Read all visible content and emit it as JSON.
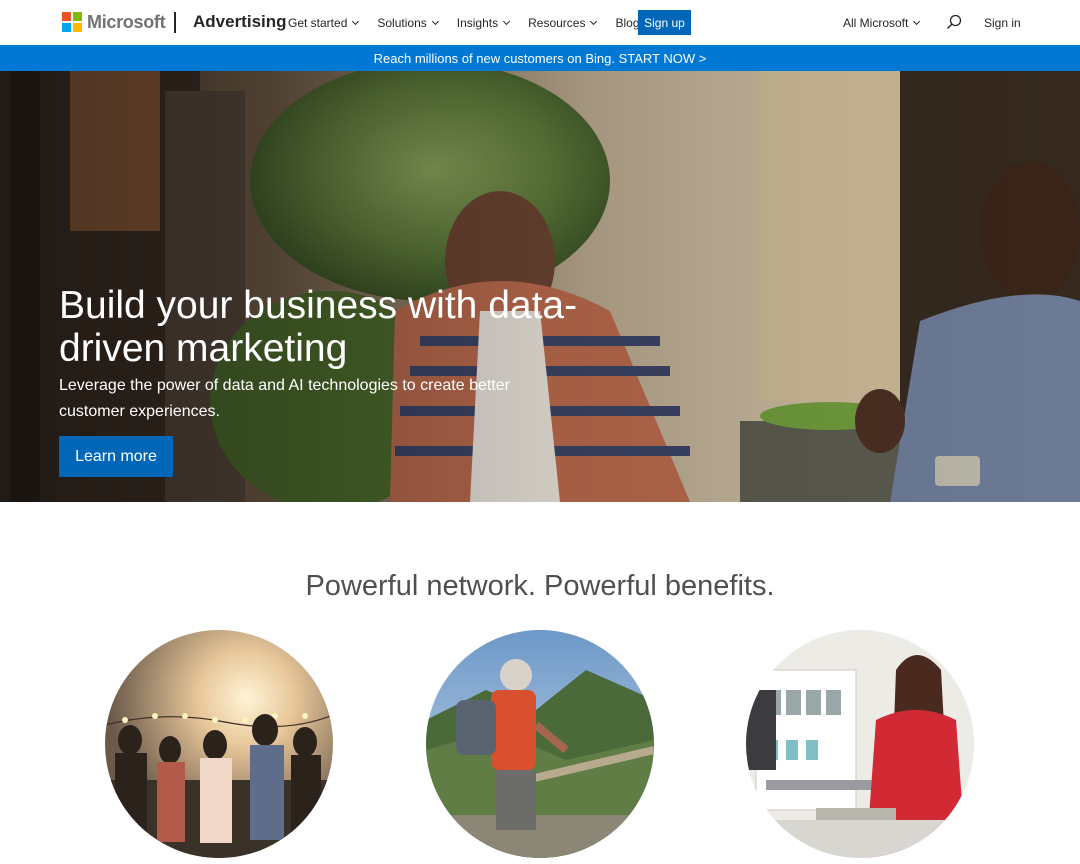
{
  "nav": {
    "logo_text": "Microsoft",
    "brand": "Advertising",
    "links": [
      {
        "label": "Get started",
        "dropdown": true
      },
      {
        "label": "Solutions",
        "dropdown": true
      },
      {
        "label": "Insights",
        "dropdown": true
      },
      {
        "label": "Resources",
        "dropdown": true
      },
      {
        "label": "Blog",
        "dropdown": false
      }
    ],
    "signup_label": "Sign up",
    "all_microsoft_label": "All Microsoft",
    "signin_label": "Sign in",
    "search_icon": "search-icon"
  },
  "promo": {
    "text": "Reach millions of new customers on Bing. START NOW >"
  },
  "hero": {
    "title": "Build your business with data-driven marketing",
    "subtitle": "Leverage the power of data and AI technologies to create better customer experiences.",
    "button_label": "Learn more"
  },
  "benefits": {
    "title": "Powerful network. Powerful benefits."
  },
  "colors": {
    "primary_blue": "#0067b8",
    "banner_blue": "#0078d4",
    "text_dark": "#262626",
    "heading_gray": "#505050"
  }
}
